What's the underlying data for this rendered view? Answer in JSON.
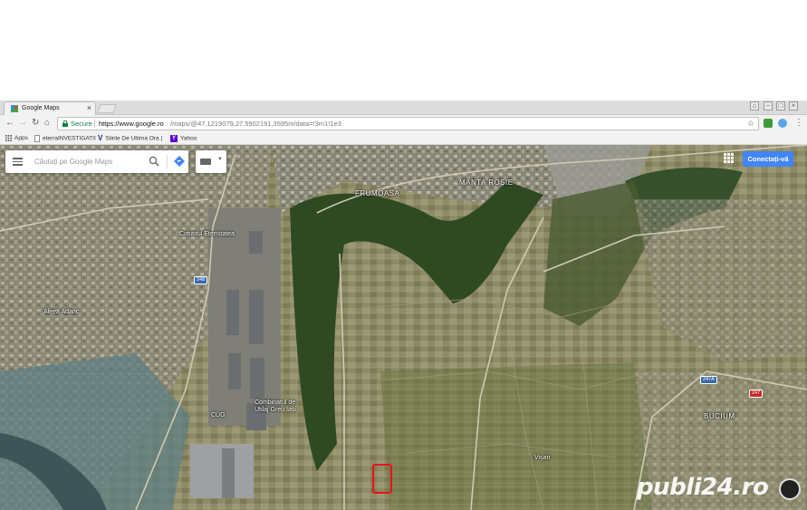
{
  "browser": {
    "tab_title": "Google Maps",
    "url": {
      "secure_label": "Secure",
      "host": "https://www.google.ro",
      "path": "/maps/@47.1219079,27.5902191,3595m/data=!3m1!1e3"
    },
    "bookmarks": [
      {
        "label": "Apps",
        "icon": "apps-grid-icon"
      },
      {
        "label": "eterraINVESTIGATII",
        "icon": "page-icon"
      },
      {
        "label": "Stirile De Ultima Ora |",
        "icon": "v-logo-icon"
      },
      {
        "label": "Yahoo",
        "icon": "yahoo-icon"
      }
    ]
  },
  "map": {
    "search_placeholder": "Căutați pe Google Maps",
    "signin_label": "Conectați-vă",
    "labels": [
      {
        "text": "FRUMOASA",
        "kind": "district"
      },
      {
        "text": "MANTA ROȘIE",
        "kind": "district"
      },
      {
        "text": "Cimitirul Eternitatea",
        "kind": "poi"
      },
      {
        "text": "Aleea Adanc",
        "kind": "street"
      },
      {
        "text": "Combinatul de Utilaj Greu Iași",
        "kind": "poi"
      },
      {
        "text": "CUG",
        "kind": "district"
      },
      {
        "text": "BUCIUM",
        "kind": "district"
      },
      {
        "text": "Vișan",
        "kind": "locality"
      }
    ],
    "route_shields": [
      "248",
      "247A",
      "247"
    ],
    "watermark": "publi24.ro",
    "colors": {
      "signin": "#4285f4",
      "parcel_outline": "#e8121c"
    }
  }
}
